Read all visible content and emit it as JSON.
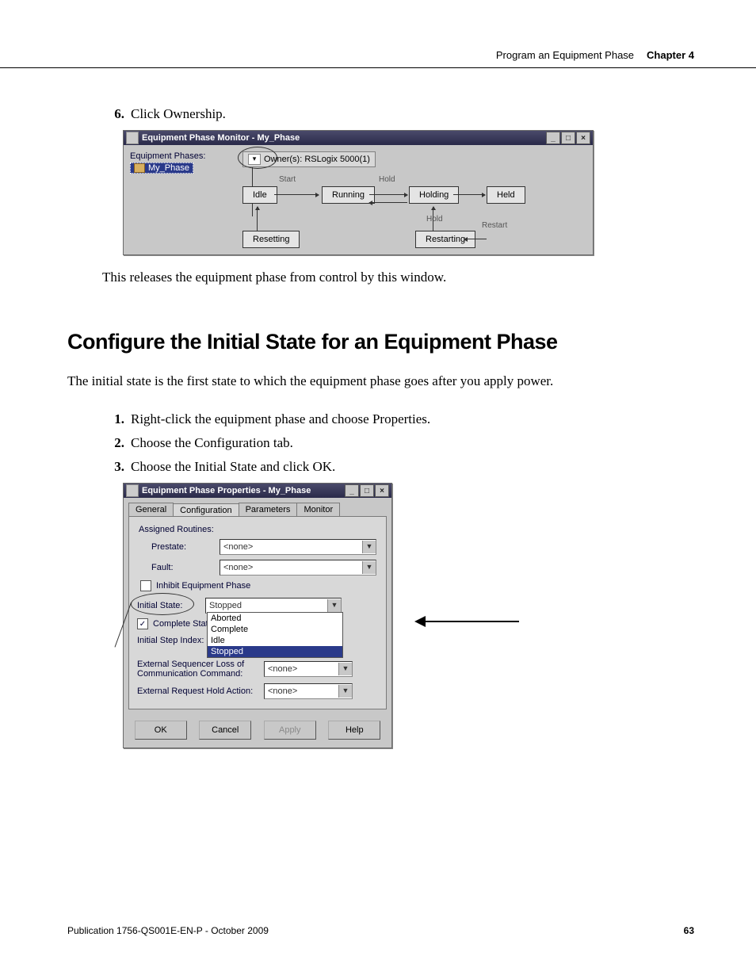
{
  "header": {
    "title": "Program an Equipment Phase",
    "chapter": "Chapter 4"
  },
  "step6": {
    "num": "6.",
    "text": "Click Ownership."
  },
  "window1": {
    "title": "Equipment Phase Monitor - My_Phase",
    "treeLabel": "Equipment Phases:",
    "treeItem": "My_Phase",
    "owners": "Owner(s): RSLogix 5000(1)",
    "labels": {
      "start": "Start",
      "hold": "Hold",
      "hold2": "Hold",
      "restart": "Restart"
    },
    "states": {
      "idle": "Idle",
      "running": "Running",
      "holding": "Holding",
      "held": "Held",
      "resetting": "Resetting",
      "restarting": "Restarting"
    }
  },
  "release_text": "This releases the equipment phase from control by this window.",
  "section_heading": "Configure the Initial State for an Equipment Phase",
  "intro_text": "The initial state is the first state to which the equipment phase goes after you apply power.",
  "step1": {
    "num": "1.",
    "text": "Right-click the equipment phase and choose Properties."
  },
  "step2": {
    "num": "2.",
    "text": "Choose the Configuration tab."
  },
  "step3": {
    "num": "3.",
    "text": "Choose the Initial State and click OK."
  },
  "window2": {
    "title": "Equipment Phase Properties - My_Phase",
    "tabs": {
      "general": "General",
      "config": "Configuration",
      "params": "Parameters",
      "monitor": "Monitor"
    },
    "assigned": "Assigned Routines:",
    "prestate": {
      "label": "Prestate:",
      "value": "<none>"
    },
    "fault": {
      "label": "Fault:",
      "value": "<none>"
    },
    "inhibit": "Inhibit Equipment Phase",
    "initial": {
      "label": "Initial State:",
      "value": "Stopped"
    },
    "options": [
      "Aborted",
      "Complete",
      "Idle",
      "Stopped"
    ],
    "complete": "Complete State",
    "initstep": {
      "label": "Initial Step Index:"
    },
    "extloss": {
      "label": "External Sequencer Loss of Communication Command:",
      "value": "<none>"
    },
    "exthold": {
      "label": "External Request Hold Action:",
      "value": "<none>"
    },
    "buttons": {
      "ok": "OK",
      "cancel": "Cancel",
      "apply": "Apply",
      "help": "Help"
    }
  },
  "footer": {
    "pub": "Publication 1756-QS001E-EN-P - October 2009",
    "page": "63"
  }
}
